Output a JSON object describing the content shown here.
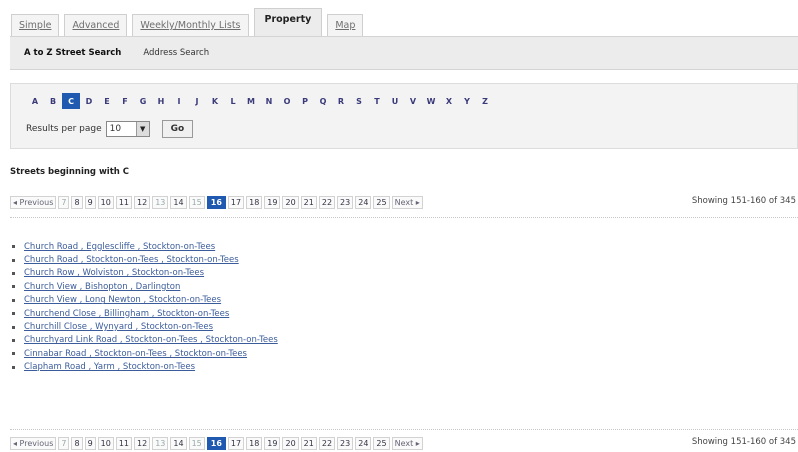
{
  "tabs": [
    {
      "label": "Simple"
    },
    {
      "label": "Advanced"
    },
    {
      "label": "Weekly/Monthly Lists"
    },
    {
      "label": "Property"
    },
    {
      "label": "Map"
    }
  ],
  "subnav": [
    {
      "label": "A to Z Street Search"
    },
    {
      "label": "Address Search"
    }
  ],
  "letters": [
    "A",
    "B",
    "C",
    "D",
    "E",
    "F",
    "G",
    "H",
    "I",
    "J",
    "K",
    "L",
    "M",
    "N",
    "O",
    "P",
    "Q",
    "R",
    "S",
    "T",
    "U",
    "V",
    "W",
    "X",
    "Y",
    "Z"
  ],
  "active_letter": "C",
  "results_per_page": {
    "label": "Results per page",
    "value": "10",
    "arrow": "▼"
  },
  "go_button": "Go",
  "heading": "Streets beginning with C",
  "pager": {
    "previous": "◂ Previous",
    "next": "Next ▸",
    "pages": [
      "7",
      "8",
      "9",
      "10",
      "11",
      "12",
      "13",
      "14",
      "15",
      "16",
      "17",
      "18",
      "19",
      "20",
      "21",
      "22",
      "23",
      "24",
      "25"
    ],
    "dim_pages": [
      "7",
      "13",
      "15"
    ],
    "current": "16",
    "showing": "Showing 151-160 of 345"
  },
  "streets": [
    "Church Road , Egglescliffe , Stockton-on-Tees",
    "Church Road , Stockton-on-Tees , Stockton-on-Tees",
    "Church Row , Wolviston , Stockton-on-Tees",
    "Church View , Bishopton , Darlington",
    "Church View , Long Newton , Stockton-on-Tees",
    "Churchend Close , Billingham , Stockton-on-Tees",
    "Churchill Close , Wynyard , Stockton-on-Tees",
    "Churchyard Link Road , Stockton-on-Tees , Stockton-on-Tees",
    "Cinnabar Road , Stockton-on-Tees , Stockton-on-Tees",
    "Clapham Road , Yarm , Stockton-on-Tees"
  ],
  "colors": {
    "accent": "#1f5ab0",
    "link": "#3b5c9a"
  }
}
